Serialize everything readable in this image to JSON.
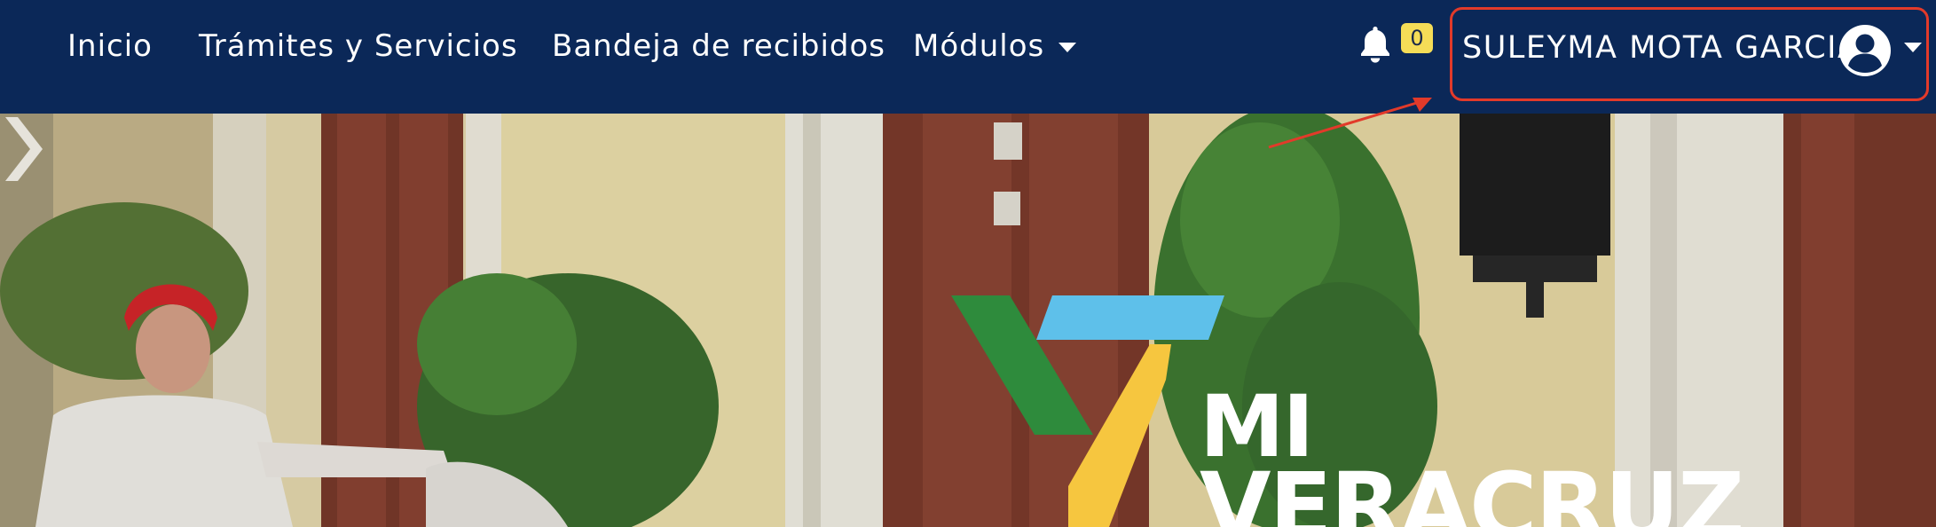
{
  "navbar": {
    "items": [
      {
        "label": "Inicio"
      },
      {
        "label": "Trámites y Servicios"
      },
      {
        "label": "Bandeja de recibidos"
      },
      {
        "label": "Módulos"
      }
    ],
    "notifications": {
      "count": "0",
      "icon": "bell-icon"
    },
    "user": {
      "name": "SULEYMA MOTA GARCIA",
      "icon": "user-avatar-icon"
    }
  },
  "hero": {
    "logo": {
      "line1": "MI",
      "line2": "VERACRUZ"
    },
    "next_icon": "chevron-right-icon"
  },
  "colors": {
    "navbar_bg": "#0b2858",
    "highlight_border": "#e23a2a",
    "badge_bg": "#f5dd57",
    "logo_green": "#2e8b3c",
    "logo_blue": "#5ec0ea",
    "logo_yellow": "#f6c63f"
  }
}
